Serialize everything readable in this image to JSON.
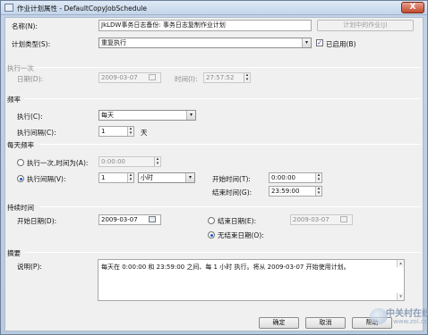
{
  "window": {
    "title": "作业计划属性 - DefaultCopyJobSchedule",
    "close_glyph": "X"
  },
  "name": {
    "label": "名称(N):",
    "value": "JkLDW事务日志备份: 事务日志复制作业计划",
    "jobs_button": "计划中的作业(J)"
  },
  "schedule_type": {
    "label": "计划类型(S):",
    "value": "重复执行",
    "enabled_label": "已启用(B)",
    "enabled_checked": true
  },
  "one_time": {
    "section": "执行一次",
    "date_label": "日期(D):",
    "date_value": "2009-03-07",
    "time_label": "时间(I):",
    "time_value": "27:57:52"
  },
  "frequency": {
    "section": "频率",
    "occurs_label": "执行(C):",
    "occurs_value": "每天",
    "recurs_label": "执行间隔(C):",
    "recurs_value": "1",
    "recurs_unit": "天"
  },
  "daily_frequency": {
    "section": "每天频率",
    "once_label": "执行一次,时间为(A):",
    "once_value": "0:00:00",
    "every_label": "执行间隔(V):",
    "every_value": "1",
    "every_unit": "小时",
    "start_label": "开始时间(T):",
    "start_value": "0:00:00",
    "end_label": "结束时间(G):",
    "end_value": "23:59:00",
    "selected": "every"
  },
  "duration": {
    "section": "持续时间",
    "start_date_label": "开始日期(D):",
    "start_date_value": "2009-03-07",
    "end_date_label": "结束日期(E):",
    "end_date_value": "2009-03-07",
    "no_end_label": "无结束日期(O):",
    "selected": "no_end"
  },
  "summary": {
    "section": "摘要",
    "description_label": "说明(P):",
    "description_value": "每天在 0:00:00 和 23:59:00 之间、每 1 小时 执行。将从 2009-03-07 开始使用计划。"
  },
  "buttons": {
    "ok": "确定",
    "cancel": "取消",
    "help": "帮助"
  },
  "watermark": {
    "brand": "中关村在线",
    "site": "www.zol.com.cn"
  },
  "icons": {
    "dropdown": "▾",
    "spin_up": "▴",
    "spin_down": "▾",
    "check": "✓"
  }
}
